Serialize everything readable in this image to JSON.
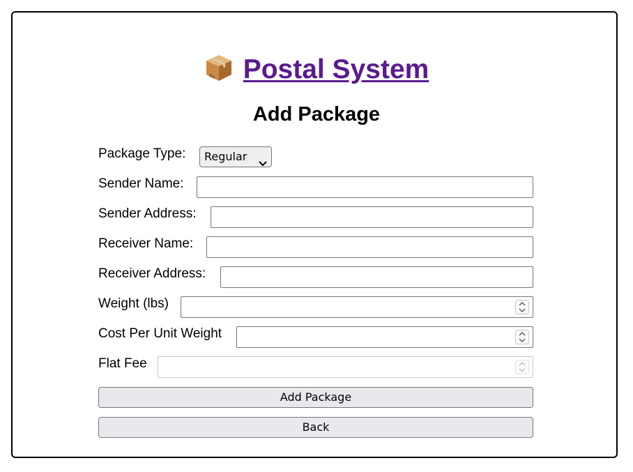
{
  "header": {
    "brand_text": "Postal System",
    "brand_icon": "package-icon",
    "brand_color": "#5a1b8f"
  },
  "page": {
    "title": "Add Package"
  },
  "form": {
    "package_type": {
      "label": "Package Type:",
      "selected": "Regular"
    },
    "sender_name": {
      "label": "Sender Name:",
      "value": ""
    },
    "sender_address": {
      "label": "Sender Address:",
      "value": ""
    },
    "receiver_name": {
      "label": "Receiver Name:",
      "value": ""
    },
    "receiver_address": {
      "label": "Receiver Address:",
      "value": ""
    },
    "weight": {
      "label": "Weight (lbs)",
      "value": ""
    },
    "cost_per_unit_weight": {
      "label": "Cost Per Unit Weight",
      "value": ""
    },
    "flat_fee": {
      "label": "Flat Fee",
      "value": "",
      "disabled": true
    }
  },
  "actions": {
    "add_label": "Add Package",
    "back_label": "Back"
  }
}
